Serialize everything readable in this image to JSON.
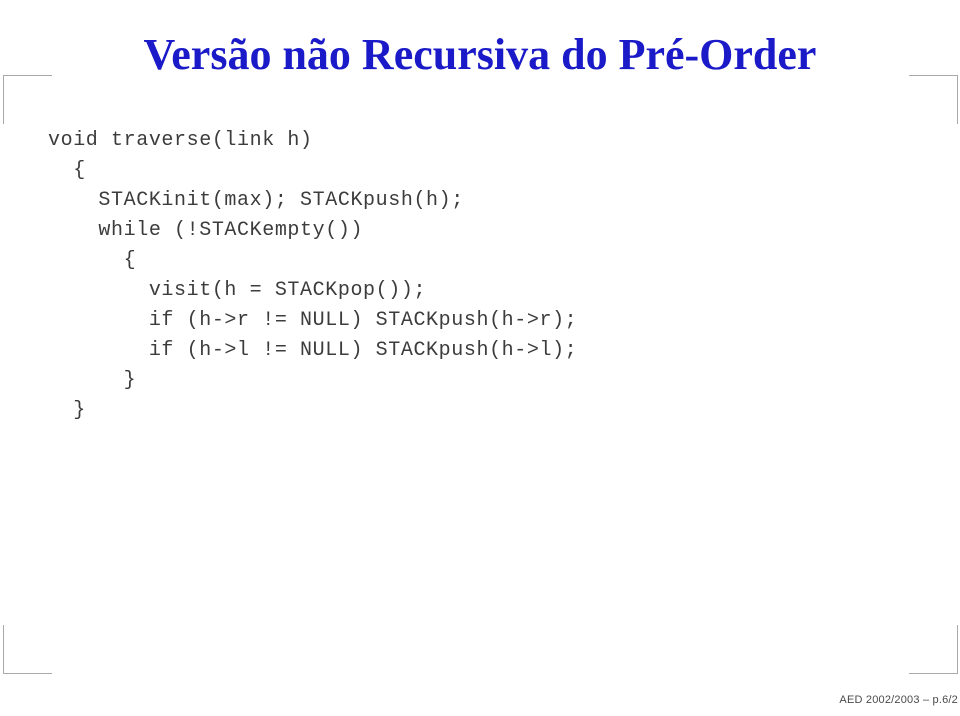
{
  "slide": {
    "title": "Versão não Recursiva do Pré-Order",
    "title_color": "#1a1ac8",
    "background_color": "#ffffff",
    "frame_color": "#a9a9a9"
  },
  "code": {
    "color": "#3c3c3c",
    "lines": [
      "void traverse(link h)",
      "  {",
      "    STACKinit(max); STACKpush(h);",
      "    while (!STACKempty())",
      "      {",
      "        visit(h = STACKpop());",
      "        if (h->r != NULL) STACKpush(h->r);",
      "        if (h->l != NULL) STACKpush(h->l);",
      "      }",
      "  }"
    ]
  },
  "footer": {
    "text": "AED 2002/2003 – p.6/2"
  }
}
